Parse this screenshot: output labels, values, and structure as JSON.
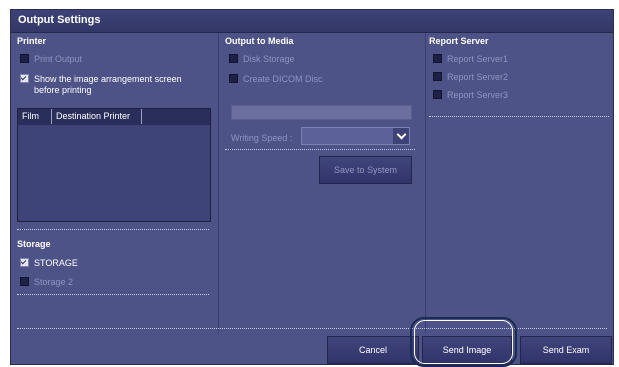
{
  "window": {
    "title": "Output Settings"
  },
  "printer": {
    "header": "Printer",
    "print_output": {
      "label": "Print Output",
      "checked": false
    },
    "show_arrangement": {
      "label_line1": "Show the image arrangement screen",
      "label_line2": "before printing",
      "checked": true
    },
    "table": {
      "columns": [
        "Film",
        "Destination Printer"
      ]
    }
  },
  "storage": {
    "header": "Storage",
    "items": [
      {
        "label": "STORAGE",
        "checked": true
      },
      {
        "label": "Storage 2",
        "checked": false
      }
    ]
  },
  "media": {
    "header": "Output to Media",
    "disk_storage": {
      "label": "Disk Storage",
      "checked": false
    },
    "create_dicom": {
      "label": "Create DICOM Disc",
      "checked": false
    },
    "writing_speed_label": "Writing Speed :",
    "writing_speed_value": "",
    "save_button": "Save to System"
  },
  "report": {
    "header": "Report Server",
    "items": [
      {
        "label": "Report Server1",
        "checked": false
      },
      {
        "label": "Report Server2",
        "checked": false
      },
      {
        "label": "Report Server3",
        "checked": false
      }
    ]
  },
  "footer": {
    "cancel": "Cancel",
    "send_image": "Send Image",
    "send_exam": "Send Exam"
  },
  "colors": {
    "panel": "#4d5287",
    "titlebar": "#323766",
    "highlight_ring": "#1b2a52"
  }
}
